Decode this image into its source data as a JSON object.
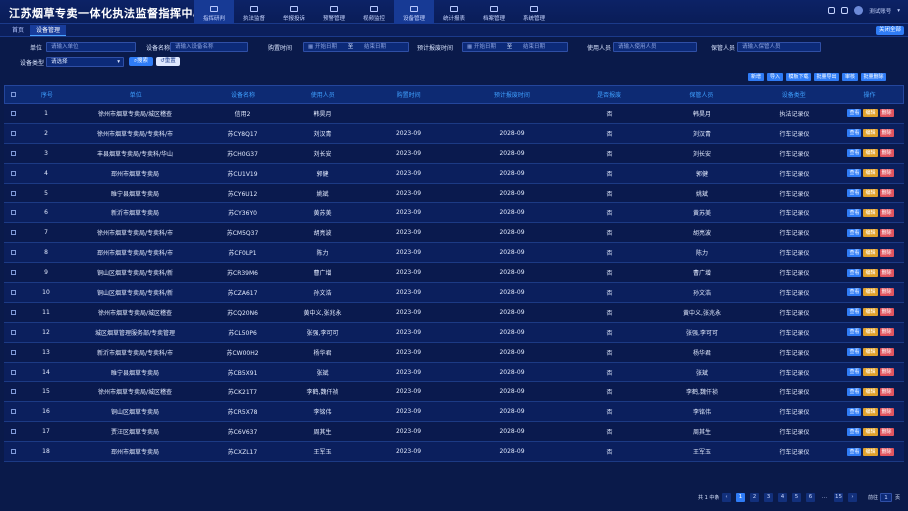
{
  "app": {
    "title": "江苏烟草专卖一体化执法监督指挥中心"
  },
  "nav": [
    {
      "label": "指挥研判"
    },
    {
      "label": "执法监督"
    },
    {
      "label": "举报投诉"
    },
    {
      "label": "预警管理"
    },
    {
      "label": "视频监控"
    },
    {
      "label": "设备管理"
    },
    {
      "label": "统计报表"
    },
    {
      "label": "档案管理"
    },
    {
      "label": "系统管理"
    }
  ],
  "user": {
    "name": "测试账号"
  },
  "tabs": [
    {
      "label": "首页"
    },
    {
      "label": "设备管理"
    }
  ],
  "tab_action": "关闭全部",
  "filters": {
    "unit_label": "单位",
    "unit_placeholder": "请输入单位",
    "device_name_label": "设备名称",
    "device_name_placeholder": "请输入设备名称",
    "buy_time_label": "购置时间",
    "buy_start": "开始日期",
    "to1": "至",
    "buy_end": "结束日期",
    "scrap_time_label": "预计报废时间",
    "scrap_start": "开始日期",
    "to2": "至",
    "scrap_end": "结束日期",
    "user_label": "使用人员",
    "user_placeholder": "请输入使用人员",
    "keeper_label": "保管人员",
    "keeper_placeholder": "请输入保管人员",
    "type_label": "设备类型",
    "type_value": "请选择",
    "search": "搜索",
    "reset": "重置"
  },
  "actions": [
    "新增",
    "导入",
    "模板下载",
    "批量导出",
    "审核",
    "批量删除"
  ],
  "table": {
    "headers": [
      "序号",
      "单位",
      "设备名称",
      "使用人员",
      "购置时间",
      "预计报废时间",
      "是否报废",
      "保管人员",
      "设备类型",
      "操作"
    ],
    "op_labels": [
      "查看",
      "编辑",
      "删除"
    ],
    "rows": [
      [
        "1",
        "徐州市烟草专卖局/城区稽查",
        "信用2",
        "韩昊月",
        "",
        "",
        "否",
        "韩昊月",
        "执法记录仪"
      ],
      [
        "2",
        "徐州市烟草专卖局/专卖科/市",
        "苏CY8Q17",
        "刘汉青",
        "2023-09",
        "2028-09",
        "否",
        "刘汉青",
        "行车记录仪"
      ],
      [
        "3",
        "丰县烟草专卖局/专卖科/华山",
        "苏CH0G37",
        "刘长安",
        "2023-09",
        "2028-09",
        "否",
        "刘长安",
        "行车记录仪"
      ],
      [
        "4",
        "邳州市烟草专卖局",
        "苏CU1V19",
        "郭健",
        "2023-09",
        "2028-09",
        "否",
        "郭健",
        "行车记录仪"
      ],
      [
        "5",
        "睢宁县烟草专卖局",
        "苏CY6U12",
        "姚斌",
        "2023-09",
        "2028-09",
        "否",
        "姚斌",
        "行车记录仪"
      ],
      [
        "6",
        "新沂市烟草专卖局",
        "苏CY36Y0",
        "黄苏美",
        "2023-09",
        "2028-09",
        "否",
        "黄苏美",
        "行车记录仪"
      ],
      [
        "7",
        "徐州市烟草专卖局/专卖科/市",
        "苏CM5Q37",
        "胡亮波",
        "2023-09",
        "2028-09",
        "否",
        "胡亮波",
        "行车记录仪"
      ],
      [
        "8",
        "邳州市烟草专卖局/专卖科/市",
        "苏CF0LP1",
        "陈力",
        "2023-09",
        "2028-09",
        "否",
        "陈力",
        "行车记录仪"
      ],
      [
        "9",
        "铜山区烟草专卖局/专卖科/新",
        "苏CR39M6",
        "曹广增",
        "2023-09",
        "2028-09",
        "否",
        "曹广增",
        "行车记录仪"
      ],
      [
        "10",
        "铜山区烟草专卖局/专卖科/新",
        "苏CZA617",
        "孙文浩",
        "2023-09",
        "2028-09",
        "否",
        "孙文浩",
        "行车记录仪"
      ],
      [
        "11",
        "徐州市烟草专卖局/城区稽查",
        "苏CQ20N6",
        "黄中义,张兆永",
        "2023-09",
        "2028-09",
        "否",
        "黄中义,张兆永",
        "行车记录仪"
      ],
      [
        "12",
        "城区烟草管理服务部/专卖管理",
        "苏CL50P6",
        "张强,李可可",
        "2023-09",
        "2028-09",
        "否",
        "张强,李可可",
        "行车记录仪"
      ],
      [
        "13",
        "新沂市烟草专卖局/专卖科/市",
        "苏CW00H2",
        "杨华君",
        "2023-09",
        "2028-09",
        "否",
        "杨华君",
        "行车记录仪"
      ],
      [
        "14",
        "睢宁县烟草专卖局",
        "苏CB5X91",
        "张斌",
        "2023-09",
        "2028-09",
        "否",
        "张斌",
        "行车记录仪"
      ],
      [
        "15",
        "徐州市烟草专卖局/城区稽查",
        "苏CK21T7",
        "李鹤,魏仟祯",
        "2023-09",
        "2028-09",
        "否",
        "李鹤,魏仟祯",
        "行车记录仪"
      ],
      [
        "16",
        "铜山区烟草专卖局",
        "苏CR5X78",
        "李铭伟",
        "2023-09",
        "2028-09",
        "否",
        "李铭伟",
        "行车记录仪"
      ],
      [
        "17",
        "贾汪区烟草专卖局",
        "苏C6V637",
        "周其生",
        "2023-09",
        "2028-09",
        "否",
        "周其生",
        "行车记录仪"
      ],
      [
        "18",
        "邳州市烟草专卖局",
        "苏CXZL17",
        "王军玉",
        "2023-09",
        "2028-09",
        "否",
        "王军玉",
        "行车记录仪"
      ]
    ]
  },
  "pager": {
    "total": "共 1 中条",
    "pages": [
      "1",
      "2",
      "3",
      "4",
      "5",
      "6",
      "...",
      "15"
    ],
    "goto_label": "前往",
    "goto_value": "1",
    "page_unit": "页"
  }
}
